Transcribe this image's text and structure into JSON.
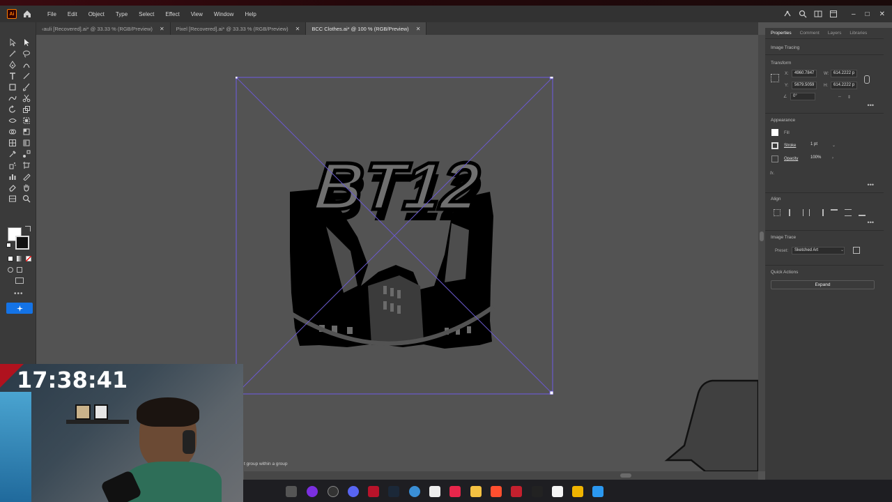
{
  "menu": {
    "app_logo": "Ai",
    "items": [
      "File",
      "Edit",
      "Object",
      "Type",
      "Select",
      "Effect",
      "View",
      "Window",
      "Help"
    ]
  },
  "tabs": [
    {
      "label": "‹auli [Recovered].ai* @ 33.33 % (RGB/Preview)",
      "active": false
    },
    {
      "label": "Pixel [Recovered].ai* @ 33.33 % (RGB/Preview)",
      "active": false
    },
    {
      "label": "BCC Clothes.ai* @ 100 % (RGB/Preview)",
      "active": true
    }
  ],
  "artwork": {
    "text": "BT12"
  },
  "status": {
    "text": "t group within a group"
  },
  "panel": {
    "tabs": [
      "Properties",
      "Comment",
      "Layers",
      "Libraries"
    ],
    "section_image_tracing": "Image Tracing",
    "section_transform": "Transform",
    "x_label": "X:",
    "x_value": "4960.7847",
    "y_label": "Y:",
    "y_value": "5679.5059",
    "w_label": "W:",
    "w_value": "614.2222 p",
    "h_label": "H:",
    "h_value": "614.2222 p",
    "angle_value": "0°",
    "section_appearance": "Appearance",
    "fill_label": "Fill",
    "stroke_label": "Stroke",
    "stroke_value": "1 pt",
    "opacity_label": "Opacity",
    "opacity_value": "100%",
    "fx_label": "fx.",
    "section_align": "Align",
    "section_image_trace": "Image Trace",
    "preset_label": "Preset:",
    "preset_value": "Sketched Art",
    "section_quick_actions": "Quick Actions",
    "expand_label": "Expand"
  },
  "webcam": {
    "clock": "17:38:41"
  },
  "colors": {
    "accent": "#1473e6",
    "selection": "#6a5acd",
    "ai_orange": "#ff7c00"
  }
}
